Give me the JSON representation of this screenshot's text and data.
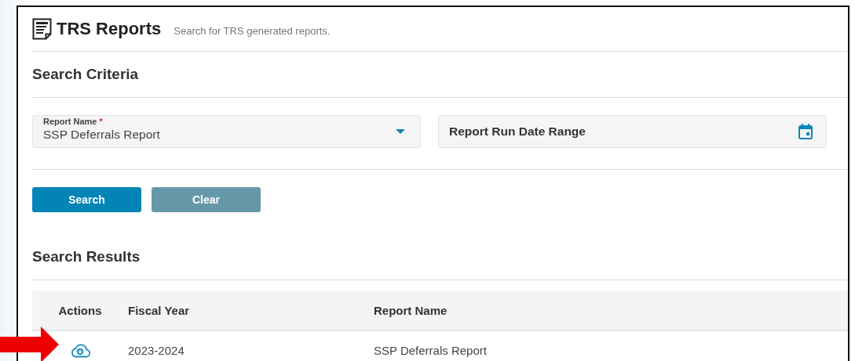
{
  "header": {
    "title": "TRS Reports",
    "subtitle": "Search for TRS generated reports."
  },
  "search_criteria": {
    "heading": "Search Criteria",
    "fields": [
      {
        "kind": "select",
        "label": "Report Name",
        "required_mark": "*",
        "value": "SSP Deferrals Report"
      },
      {
        "kind": "date",
        "placeholder": "Report Run Date Range"
      }
    ],
    "buttons": [
      {
        "label": "Search",
        "disabled": false
      },
      {
        "label": "Clear",
        "disabled": true
      }
    ]
  },
  "search_results": {
    "heading": "Search Results",
    "table": {
      "columns": [
        "Actions",
        "Fiscal Year",
        "Report Name"
      ],
      "rows": [
        {
          "kind": "download",
          "cells": [
            "",
            "2023-2024",
            "SSP Deferrals Report"
          ]
        }
      ]
    }
  }
}
